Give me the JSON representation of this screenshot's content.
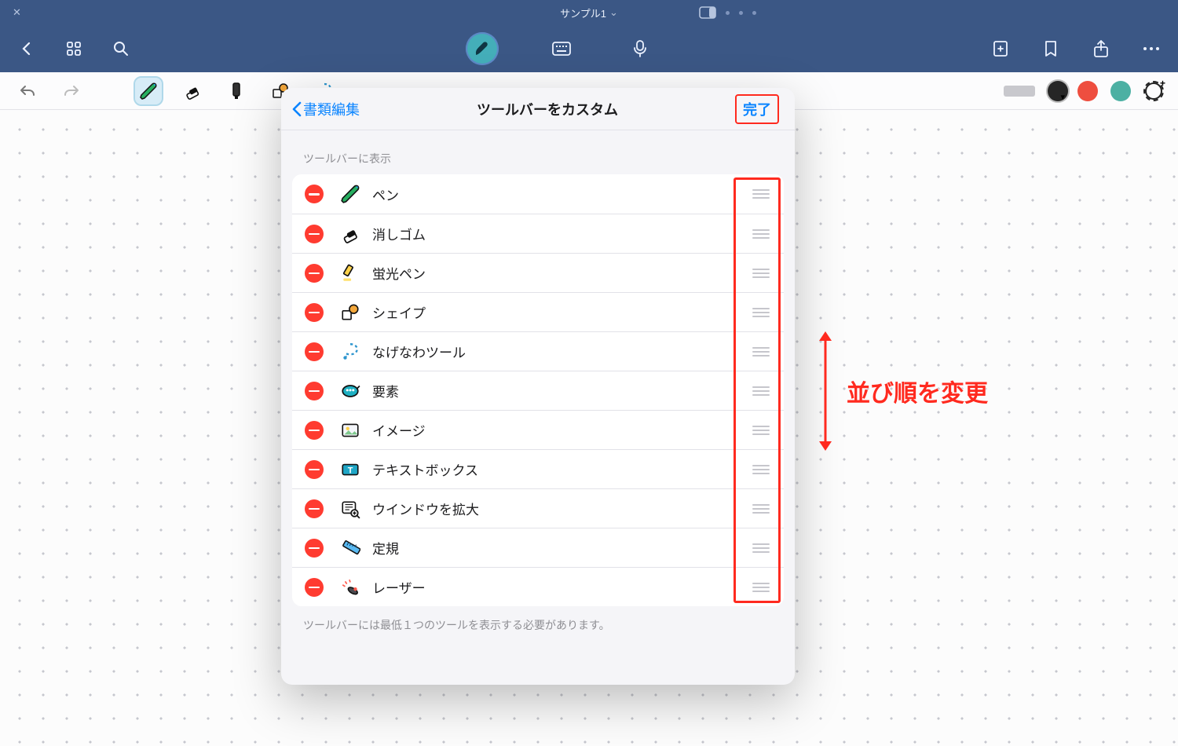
{
  "titlebar": {
    "document_name": "サンプル1"
  },
  "modal": {
    "back_label": "書類編集",
    "title": "ツールバーをカスタム",
    "done_label": "完了",
    "section_header": "ツールバーに表示",
    "footnote": "ツールバーには最低１つのツールを表示する必要があります。",
    "items": [
      {
        "label": "ペン",
        "icon": "pen"
      },
      {
        "label": "消しゴム",
        "icon": "eraser"
      },
      {
        "label": "蛍光ペン",
        "icon": "highlighter"
      },
      {
        "label": "シェイプ",
        "icon": "shape"
      },
      {
        "label": "なげなわツール",
        "icon": "lasso"
      },
      {
        "label": "要素",
        "icon": "element"
      },
      {
        "label": "イメージ",
        "icon": "image"
      },
      {
        "label": "テキストボックス",
        "icon": "textbox"
      },
      {
        "label": "ウインドウを拡大",
        "icon": "zoomwin"
      },
      {
        "label": "定規",
        "icon": "ruler"
      },
      {
        "label": "レーザー",
        "icon": "laser"
      }
    ]
  },
  "annotation": {
    "text": "並び順を変更"
  }
}
